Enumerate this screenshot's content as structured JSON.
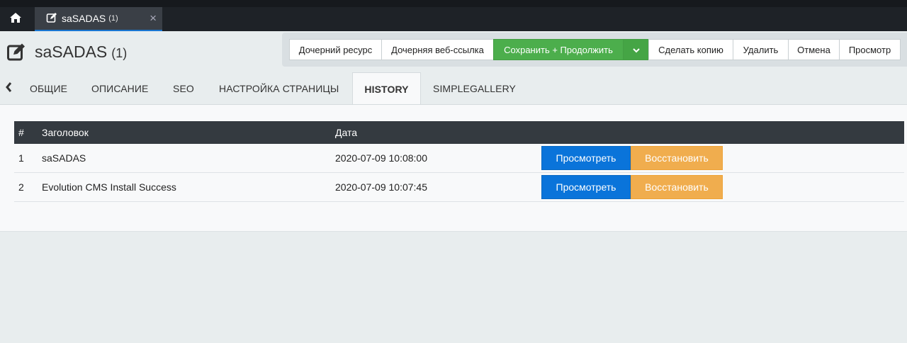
{
  "tabbar": {
    "home_icon": "home-icon",
    "doc_tab": {
      "icon": "edit-icon",
      "label": "saSADAS",
      "count": "(1)",
      "close": "×"
    }
  },
  "header": {
    "icon": "edit-icon",
    "title": "saSADAS",
    "count": "(1)"
  },
  "toolbar": {
    "child_resource": "Дочерний ресурс",
    "child_weblink": "Дочерняя веб-ссылка",
    "save_continue": "Сохранить + Продолжить",
    "make_copy": "Сделать копию",
    "delete": "Удалить",
    "cancel": "Отмена",
    "preview": "Просмотр"
  },
  "tabs": {
    "items": [
      {
        "label": "ОБЩИЕ"
      },
      {
        "label": "ОПИСАНИЕ"
      },
      {
        "label": "SEO"
      },
      {
        "label": "НАСТРОЙКА СТРАНИЦЫ"
      },
      {
        "label": "HISTORY"
      },
      {
        "label": "SIMPLEGALLERY"
      }
    ],
    "active": "HISTORY"
  },
  "history": {
    "columns": {
      "num": "#",
      "title": "Заголовок",
      "date": "Дата"
    },
    "rows": [
      {
        "num": "1",
        "title": "saSADAS",
        "date": "2020-07-09 10:08:00",
        "view": "Просмотреть",
        "restore": "Восстановить"
      },
      {
        "num": "2",
        "title": "Evolution CMS Install Success",
        "date": "2020-07-09 10:07:45",
        "view": "Просмотреть",
        "restore": "Восстановить"
      }
    ]
  },
  "colors": {
    "accent": "#1976d2",
    "success": "#4cae4c",
    "primary": "#0a74da",
    "warning": "#f0ad4e",
    "dark": "#343a40"
  }
}
